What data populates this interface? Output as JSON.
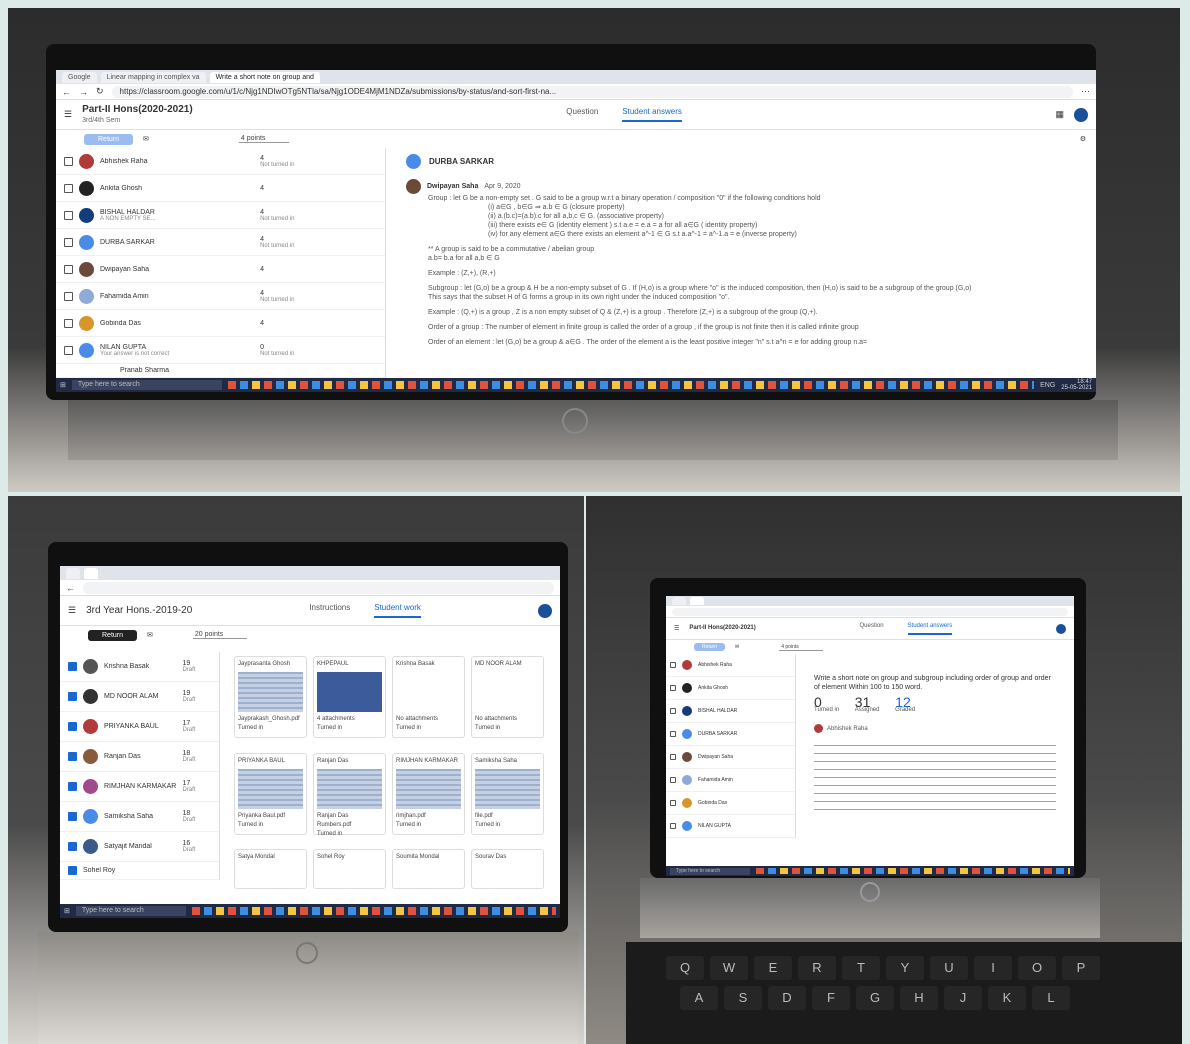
{
  "photo_top": {
    "browser_tabs": [
      "Google",
      "Linear mapping in complex va",
      "Write a short note on group and"
    ],
    "url": "https://classroom.google.com/u/1/c/Njg1NDIwOTg5NTla/sa/Njg1ODE4MjM1NDZa/submissions/by-status/and-sort-first-na...",
    "course_title": "Part-II Hons(2020-2021)",
    "course_subtitle": "3rd/4th Sem",
    "nav_tabs": [
      "Question",
      "Student answers"
    ],
    "return_label": "Return",
    "points_select": "4 points",
    "students": [
      {
        "name": "Abhishek Raha",
        "sub": "",
        "grade": "4",
        "status": "Not turned in"
      },
      {
        "name": "Ankita Ghosh",
        "sub": "",
        "grade": "4",
        "status": ""
      },
      {
        "name": "BISHAL HALDAR",
        "sub": "A NON EMPTY SE...",
        "grade": "4",
        "status": "Not turned in"
      },
      {
        "name": "DURBA SARKAR",
        "sub": "",
        "grade": "4",
        "status": "Not turned in"
      },
      {
        "name": "Dwipayan Saha",
        "sub": "",
        "grade": "4",
        "status": ""
      },
      {
        "name": "Fahamida Amin",
        "sub": "",
        "grade": "4",
        "status": "Not turned in"
      },
      {
        "name": "Gobinda Das",
        "sub": "",
        "grade": "4",
        "status": ""
      },
      {
        "name": "NILAN GUPTA",
        "sub": "Your answer is not correct",
        "grade": "0",
        "status": "Not turned in"
      },
      {
        "name": "Pranab Sharma",
        "sub": "",
        "grade": "",
        "status": ""
      }
    ],
    "detail_header": "DURBA SARKAR",
    "post_author": "Dwipayan Saha",
    "post_date": "Apr 9, 2020",
    "post_lines": [
      "Group : let G be a non-empty set . G said to be a group w.r.t a binary operation / composition \"0\" if the following conditions hold",
      "(i) a∈G , b∈G ⇒ a.b ∈ G (closure property)",
      "(ii) a.(b.c)=(a.b).c for all a,b,c ∈ G.     (associative property)",
      "(iii) there exists e∈ G (identity element ) s.t a.e = e.a = a for all a∈G ( identity property)",
      "(iv) for any element a∈G there exists an element a^-1 ∈ G s.t a.a^-1 = a^-1.a = e (inverse property)",
      "** A group is said to be a commutative / abelian group",
      "a.b= b.a for all a,b ∈ G",
      "Example : (Z,+), (R,+)",
      "Subgroup : let (G,o) be a group & H be a non-empty subset of G . If (H,o) is a group where \"o\" is the induced composition, then (H,o) is said to be a subgroup of the group (G,o)",
      "This says that the subset H of G forms a group in its own right under the induced composition \"o\".",
      "Example : (Q,+) is a group , Z is a non empty subset of Q & (Z,+) is a group . Therefore (Z,+) is a subgroup of the group (Q,+).",
      "Order of a group : The number of element in finite group is called the order of a group , if the group is not finite then it is called infinite group",
      "Order of an element : let (G,o) be a group & a∈G . The order of the element a is the least positive integer \"n\" s.t a^n = e for adding group n.a="
    ],
    "taskbar_search": "Type here to search",
    "taskbar_lang": "ENG",
    "taskbar_time": "18:47",
    "taskbar_date": "25-05-2021"
  },
  "photo_bottom_left": {
    "course_title": "3rd Year Hons.-2019-20",
    "nav_tabs": [
      "Instructions",
      "Student work"
    ],
    "return_label": "Return",
    "points_select": "20 points",
    "students": [
      {
        "name": "Krishna Basak",
        "grade": "19",
        "status": "Draft"
      },
      {
        "name": "MD NOOR ALAM",
        "grade": "19",
        "status": "Draft"
      },
      {
        "name": "PRIYANKA BAUL",
        "grade": "17",
        "status": "Draft"
      },
      {
        "name": "Ranjan Das",
        "grade": "18",
        "status": "Draft"
      },
      {
        "name": "RIMJHAN KARMAKAR",
        "grade": "17",
        "status": "Draft"
      },
      {
        "name": "Samiksha Saha",
        "grade": "18",
        "status": "Draft"
      },
      {
        "name": "Satyajit Mandal",
        "grade": "16",
        "status": "Draft"
      },
      {
        "name": "Sohel Roy",
        "grade": "",
        "status": ""
      }
    ],
    "cards": [
      {
        "name": "Jayprasanta Ghosh",
        "file": "Jayprakash_Ghosh.pdf",
        "status": "Turned in"
      },
      {
        "name": "KHPEPAUL",
        "file": "4 attachments",
        "status": "Turned in"
      },
      {
        "name": "Krishna Basak",
        "file": "No attachments",
        "status": "Turned in"
      },
      {
        "name": "MD NOOR ALAM",
        "file": "No attachments",
        "status": "Turned in"
      },
      {
        "name": "PRIYANKA BAUL",
        "file": "Priyanka Baul.pdf",
        "status": "Turned in"
      },
      {
        "name": "Ranjan Das",
        "file": "Ranjan Das Rumbers.pdf",
        "status": "Turned in"
      },
      {
        "name": "RIMJHAN KARMAKAR",
        "file": "rimjhan.pdf",
        "status": "Turned in"
      },
      {
        "name": "Samiksha Saha",
        "file": "file.pdf",
        "status": "Turned in"
      },
      {
        "name": "Satya Mondal",
        "file": "",
        "status": ""
      },
      {
        "name": "Sohel Roy",
        "file": "",
        "status": ""
      },
      {
        "name": "Soumita Mondal",
        "file": "",
        "status": ""
      },
      {
        "name": "Sourav Das",
        "file": "",
        "status": ""
      }
    ],
    "taskbar_search": "Type here to search"
  },
  "photo_bottom_right": {
    "course_title": "Part-II Hons(2020-2021)",
    "nav_tabs": [
      "Question",
      "Student answers"
    ],
    "return_label": "Return",
    "points_select": "4 points",
    "question": "Write a short note on group and subgroup including order of group and order of element Within 100 to 150 word.",
    "stats": [
      {
        "value": "0",
        "label": "Turned in"
      },
      {
        "value": "31",
        "label": "Assigned"
      },
      {
        "value": "12",
        "label": "Graded"
      }
    ],
    "first_answer_name": "Abhishek Raha",
    "students": [
      {
        "name": "Abhishek Raha"
      },
      {
        "name": "Ankita Ghosh"
      },
      {
        "name": "BISHAL HALDAR"
      },
      {
        "name": "DURBA SARKAR"
      },
      {
        "name": "Dwipayan Saha"
      },
      {
        "name": "Fahamida Amin"
      },
      {
        "name": "Gobinda Das"
      },
      {
        "name": "NILAN GUPTA"
      }
    ],
    "keyboard_rows": [
      [
        "Q",
        "W",
        "E",
        "R",
        "T",
        "Y",
        "U",
        "I",
        "O",
        "P"
      ],
      [
        "A",
        "S",
        "D",
        "F",
        "G",
        "H",
        "J",
        "K",
        "L"
      ]
    ],
    "taskbar_search": "Type here to search"
  },
  "colors": {
    "accent": "#1967d2",
    "taskbar": "#202a44",
    "return_button": "#9bbcf0"
  }
}
